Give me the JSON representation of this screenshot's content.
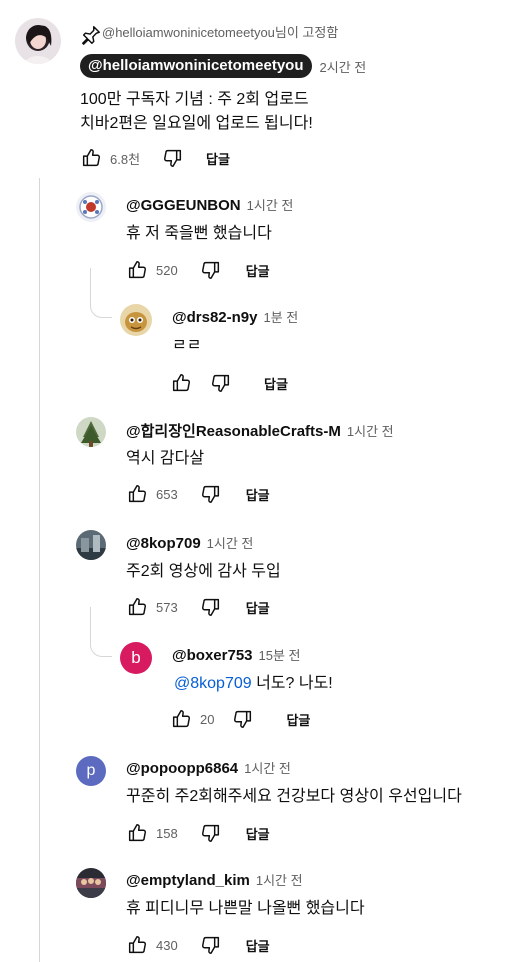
{
  "pinned": {
    "pinned_by": "@helloiamwoninicetomeetyou님이 고정함",
    "author": "@helloiamwoninicetomeetyou",
    "time": "2시간 전",
    "line1": "100만 구독자 기념 : 주 2회 업로드",
    "line2": "치바2편은 일요일에 업로드 됩니다!",
    "likes": "6.8천",
    "reply_label": "답글"
  },
  "replies": [
    {
      "author": "@GGGEUNBON",
      "time": "1시간 전",
      "text": "휴 저 죽을뻔 했습니다",
      "likes": "520",
      "reply_label": "답글"
    },
    {
      "author": "@drs82-n9y",
      "time": "1분 전",
      "text": "ㄹㄹ",
      "likes": "",
      "reply_label": "답글"
    },
    {
      "author": "@합리장인ReasonableCrafts-M",
      "time": "1시간 전",
      "text": "역시 감다살",
      "likes": "653",
      "reply_label": "답글"
    },
    {
      "author": "@8kop709",
      "time": "1시간 전",
      "text": "주2회 영상에 감사 두입",
      "likes": "573",
      "reply_label": "답글"
    },
    {
      "author": "@boxer753",
      "time": "15분 전",
      "mention": "@8kop709",
      "text": " 너도? 나도!",
      "likes": "20",
      "reply_label": "답글",
      "avatar_letter": "b"
    },
    {
      "author": "@popoopp6864",
      "time": "1시간 전",
      "text": "꾸준히 주2회해주세요 건강보다 영상이 우선입니다",
      "likes": "158",
      "reply_label": "답글",
      "avatar_letter": "p"
    },
    {
      "author": "@emptyland_kim",
      "time": "1시간 전",
      "text": "휴 피디니무 나쁜말 나올뻔 했습니다",
      "likes": "430",
      "reply_label": "답글"
    }
  ],
  "colors": {
    "boxer_avatar": "#d81b60",
    "popo_avatar": "#5c6bc0",
    "mention": "#065fd4"
  }
}
